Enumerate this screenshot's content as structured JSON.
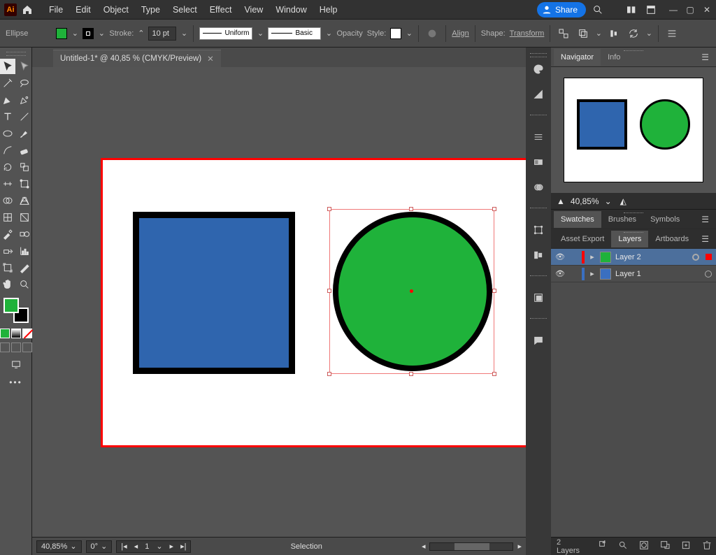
{
  "app": {
    "badge": "Ai"
  },
  "menu": [
    "File",
    "Edit",
    "Object",
    "Type",
    "Select",
    "Effect",
    "View",
    "Window",
    "Help"
  ],
  "share": "Share",
  "control": {
    "shape": "Ellipse",
    "fill": "#1fb23a",
    "strokeColor": "#000000",
    "strokeLabel": "Stroke:",
    "strokeVal": "10 pt",
    "profile1": "Uniform",
    "profile2": "Basic",
    "opacityLabel": "Opacity",
    "styleLabel": "Style:",
    "align": "Align",
    "shapeLabel": "Shape:",
    "transform": "Transform"
  },
  "doc": {
    "title": "Untitled-1* @ 40,85 % (CMYK/Preview)"
  },
  "status": {
    "zoom": "40,85%",
    "rotate": "0°",
    "artboard": "1",
    "tool": "Selection"
  },
  "panels": {
    "nav": {
      "tabs": [
        "Navigator",
        "Info"
      ],
      "zoom": "40,85%"
    },
    "swatches": {
      "tabs": [
        "Swatches",
        "Brushes",
        "Symbols"
      ]
    },
    "layers": {
      "tabs": [
        "Asset Export",
        "Layers",
        "Artboards"
      ],
      "rows": [
        {
          "name": "Layer 2",
          "color": "#ff0000",
          "swatch": "#1fb23a",
          "selected": true,
          "target": true
        },
        {
          "name": "Layer 1",
          "color": "#3a6fc0",
          "swatch": "#3a6fc0",
          "selected": false,
          "target": false
        }
      ],
      "footer": "2 Layers"
    }
  }
}
